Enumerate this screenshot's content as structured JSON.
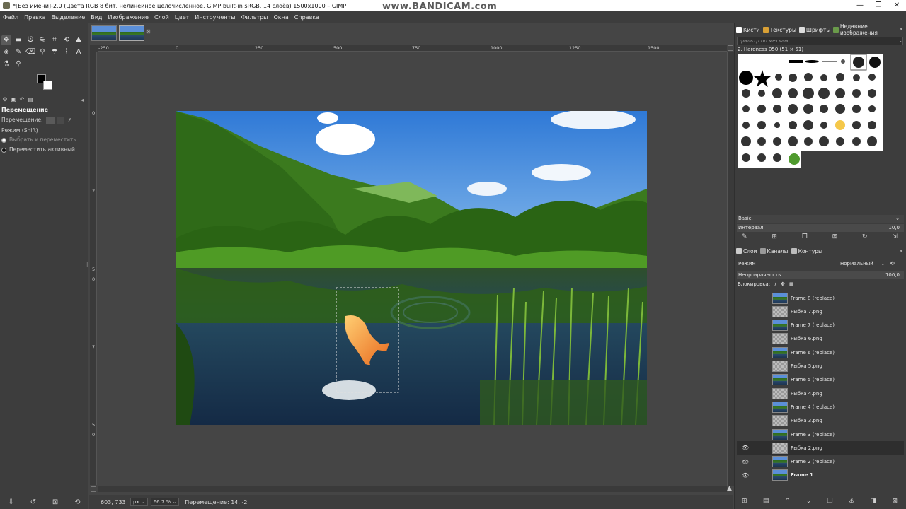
{
  "window": {
    "title": "*[Без имени]-2.0 (Цвета RGB 8 бит, нелинейное целочисленное, GIMP built-in sRGB, 14 слоёв) 1500x1000 – GIMP",
    "watermark": "www.BANDICAM.com"
  },
  "menu": [
    "Файл",
    "Правка",
    "Выделение",
    "Вид",
    "Изображение",
    "Слой",
    "Цвет",
    "Инструменты",
    "Фильтры",
    "Окна",
    "Справка"
  ],
  "tool_options": {
    "title": "Перемещение",
    "move_label": "Перемещение:",
    "mode_label": "Режим (Shift)",
    "option_pick": "Выбрать и переместить",
    "option_active": "Переместить активный"
  },
  "rulers": {
    "h_ticks": [
      "-250",
      "0",
      "250",
      "500",
      "750",
      "1000",
      "1250",
      "1500"
    ],
    "v_ticks": [
      "0",
      "2",
      "5",
      "0",
      "7",
      "5",
      "0"
    ]
  },
  "status": {
    "coords": "603, 733",
    "unit": "px",
    "zoom": "66.7 %",
    "message": "Перемещение: 14, -2"
  },
  "dock_top": {
    "tabs": [
      "Кисти",
      "Текстуры",
      "Шрифты",
      "Недавние изображения"
    ],
    "filter_placeholder": "фильтр по меткам",
    "brush_name": "2. Hardness 050 (51 × 51)",
    "preset": "Basic,",
    "spacing_label": "Интервал",
    "spacing_value": "10,0"
  },
  "dock_layers": {
    "tabs": [
      "Слои",
      "Каналы",
      "Контуры"
    ],
    "mode_label": "Режим",
    "mode_value": "Нормальный",
    "opacity_label": "Непрозрачность",
    "opacity_value": "100,0",
    "lock_label": "Блокировка:",
    "layers": [
      {
        "name": "Frame 8 (replace)",
        "type": "frame",
        "visible": false,
        "selected": false,
        "bold": false
      },
      {
        "name": "Рыбка 7.png",
        "type": "fish",
        "visible": false,
        "selected": false,
        "bold": false
      },
      {
        "name": "Frame 7 (replace)",
        "type": "frame",
        "visible": false,
        "selected": false,
        "bold": false
      },
      {
        "name": "Рыбка 6.png",
        "type": "fish",
        "visible": false,
        "selected": false,
        "bold": false
      },
      {
        "name": "Frame 6 (replace)",
        "type": "frame",
        "visible": false,
        "selected": false,
        "bold": false
      },
      {
        "name": "Рыбка 5.png",
        "type": "fish",
        "visible": false,
        "selected": false,
        "bold": false
      },
      {
        "name": "Frame 5 (replace)",
        "type": "frame",
        "visible": false,
        "selected": false,
        "bold": false
      },
      {
        "name": "Рыбка 4.png",
        "type": "fish",
        "visible": false,
        "selected": false,
        "bold": false
      },
      {
        "name": "Frame 4 (replace)",
        "type": "frame",
        "visible": false,
        "selected": false,
        "bold": false
      },
      {
        "name": "Рыбка 3.png",
        "type": "fish",
        "visible": false,
        "selected": false,
        "bold": false
      },
      {
        "name": "Frame 3 (replace)",
        "type": "frame",
        "visible": false,
        "selected": false,
        "bold": false
      },
      {
        "name": "Рыбка 2.png",
        "type": "fish",
        "visible": true,
        "selected": true,
        "bold": false
      },
      {
        "name": "Frame 2 (replace)",
        "type": "frame",
        "visible": true,
        "selected": false,
        "bold": false
      },
      {
        "name": "Frame 1",
        "type": "frame",
        "visible": true,
        "selected": false,
        "bold": true
      }
    ]
  }
}
